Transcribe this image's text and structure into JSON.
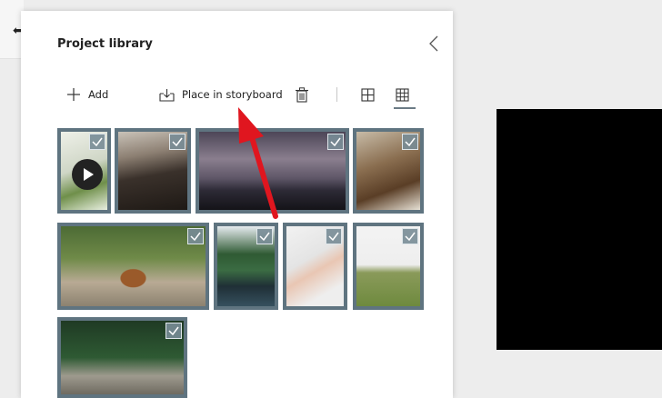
{
  "panel": {
    "title": "Project library"
  },
  "toolbar": {
    "add_label": "Add",
    "place_label": "Place in storyboard",
    "delete_icon": "trash-icon",
    "view_grid_large_icon": "grid-2x2-icon",
    "view_grid_small_icon": "grid-3x3-icon",
    "active_view": "grid-3x3"
  },
  "thumbnails": [
    {
      "subject": "salad-with-video",
      "selected": true,
      "video": true
    },
    {
      "subject": "rock-formation",
      "selected": true
    },
    {
      "subject": "city-skyline",
      "selected": true
    },
    {
      "subject": "cafe-person",
      "selected": true
    },
    {
      "subject": "dog-on-path",
      "selected": true
    },
    {
      "subject": "forest-lake",
      "selected": true
    },
    {
      "subject": "hand-holding-bottle",
      "selected": true
    },
    {
      "subject": "grassy-hill",
      "selected": true
    },
    {
      "subject": "picnic-overhead",
      "selected": true
    }
  ],
  "colors": {
    "thumb_border": "#5f7480",
    "annotation_arrow": "#e0161f"
  }
}
